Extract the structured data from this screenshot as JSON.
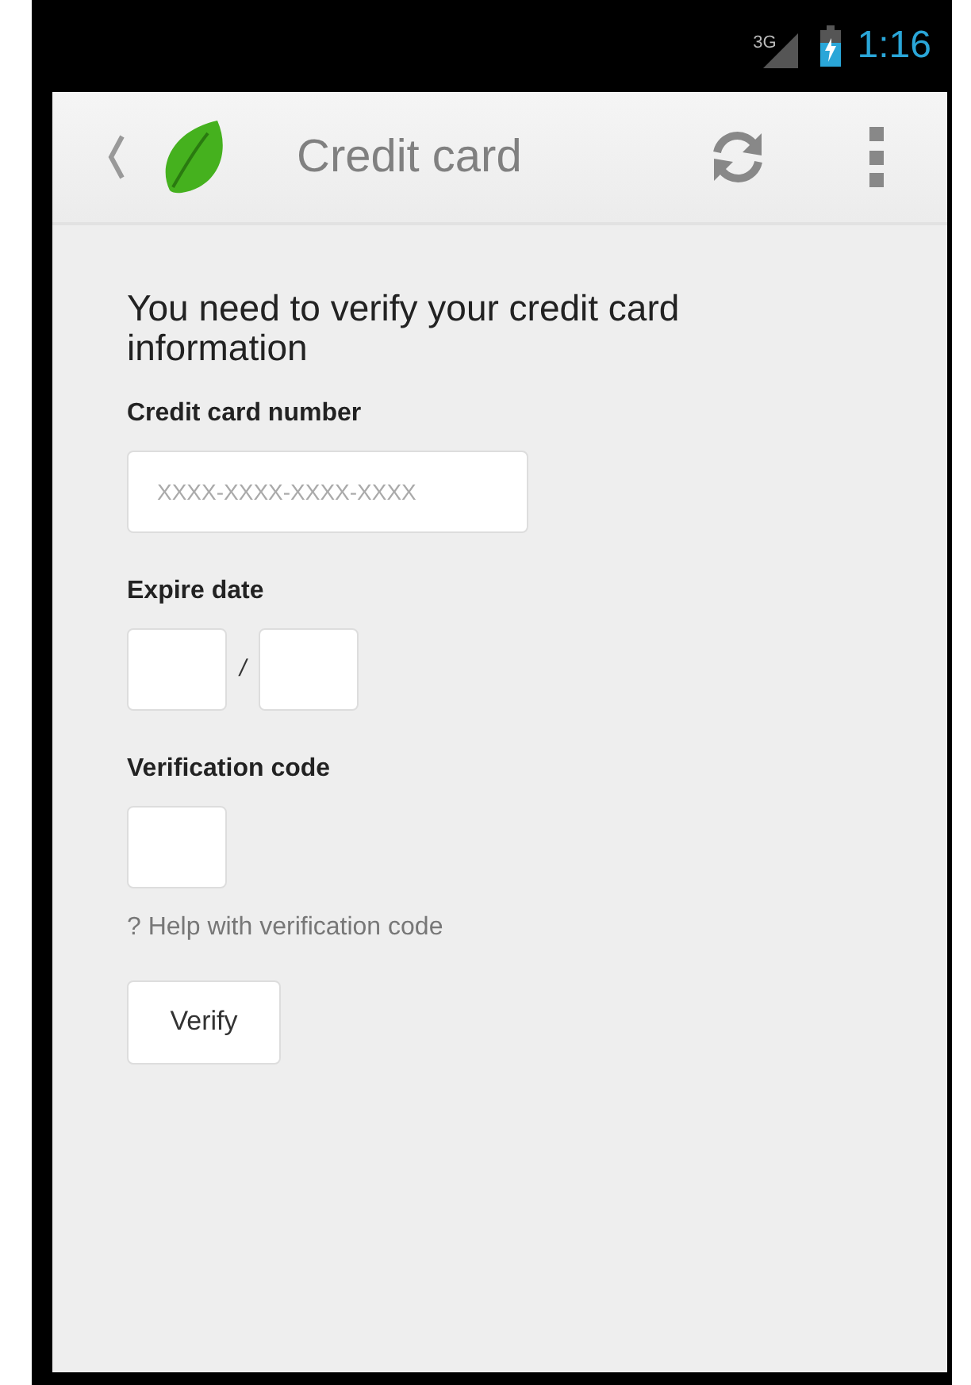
{
  "status_bar": {
    "network": "3G",
    "time": "1:16"
  },
  "action_bar": {
    "title": "Credit card"
  },
  "heading": "You need to verify your credit card information",
  "card_number": {
    "label": "Credit card number",
    "placeholder": "XXXX-XXXX-XXXX-XXXX"
  },
  "expire_date": {
    "label": "Expire date",
    "separator": "/"
  },
  "verification_code": {
    "label": "Verification code"
  },
  "help_link": "? Help with verification code",
  "verify_button": "Verify"
}
